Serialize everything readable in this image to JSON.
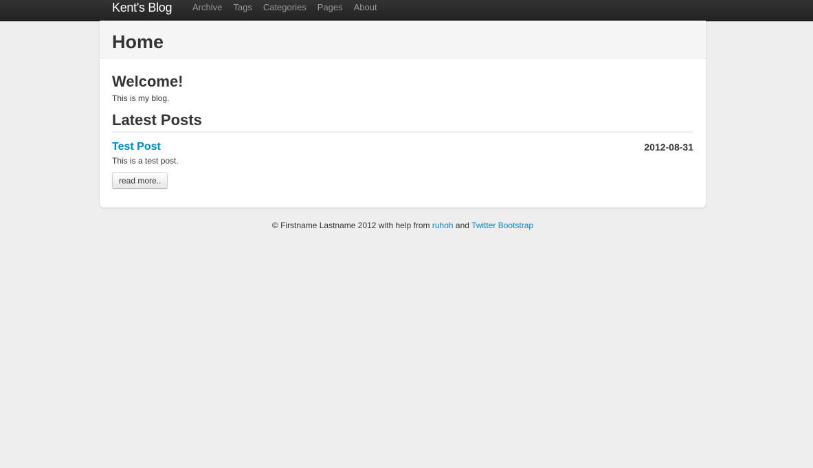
{
  "navbar": {
    "brand": "Kent's Blog",
    "items": [
      {
        "label": "Archive"
      },
      {
        "label": "Tags"
      },
      {
        "label": "Categories"
      },
      {
        "label": "Pages"
      },
      {
        "label": "About"
      }
    ]
  },
  "page": {
    "title": "Home",
    "welcome_heading": "Welcome!",
    "welcome_text": "This is my blog.",
    "latest_heading": "Latest Posts"
  },
  "posts": [
    {
      "title": "Test Post",
      "date": "2012-08-31",
      "summary": "This is a test post.",
      "read_more_label": "read more.."
    }
  ],
  "footer": {
    "prefix": "© Firstname Lastname 2012 with help from",
    "link1": "ruhoh",
    "conjunction": "and",
    "link2": "Twitter Bootstrap"
  },
  "colors": {
    "link": "#0088cc",
    "navbar": "#222222",
    "background": "#eeeeee"
  }
}
